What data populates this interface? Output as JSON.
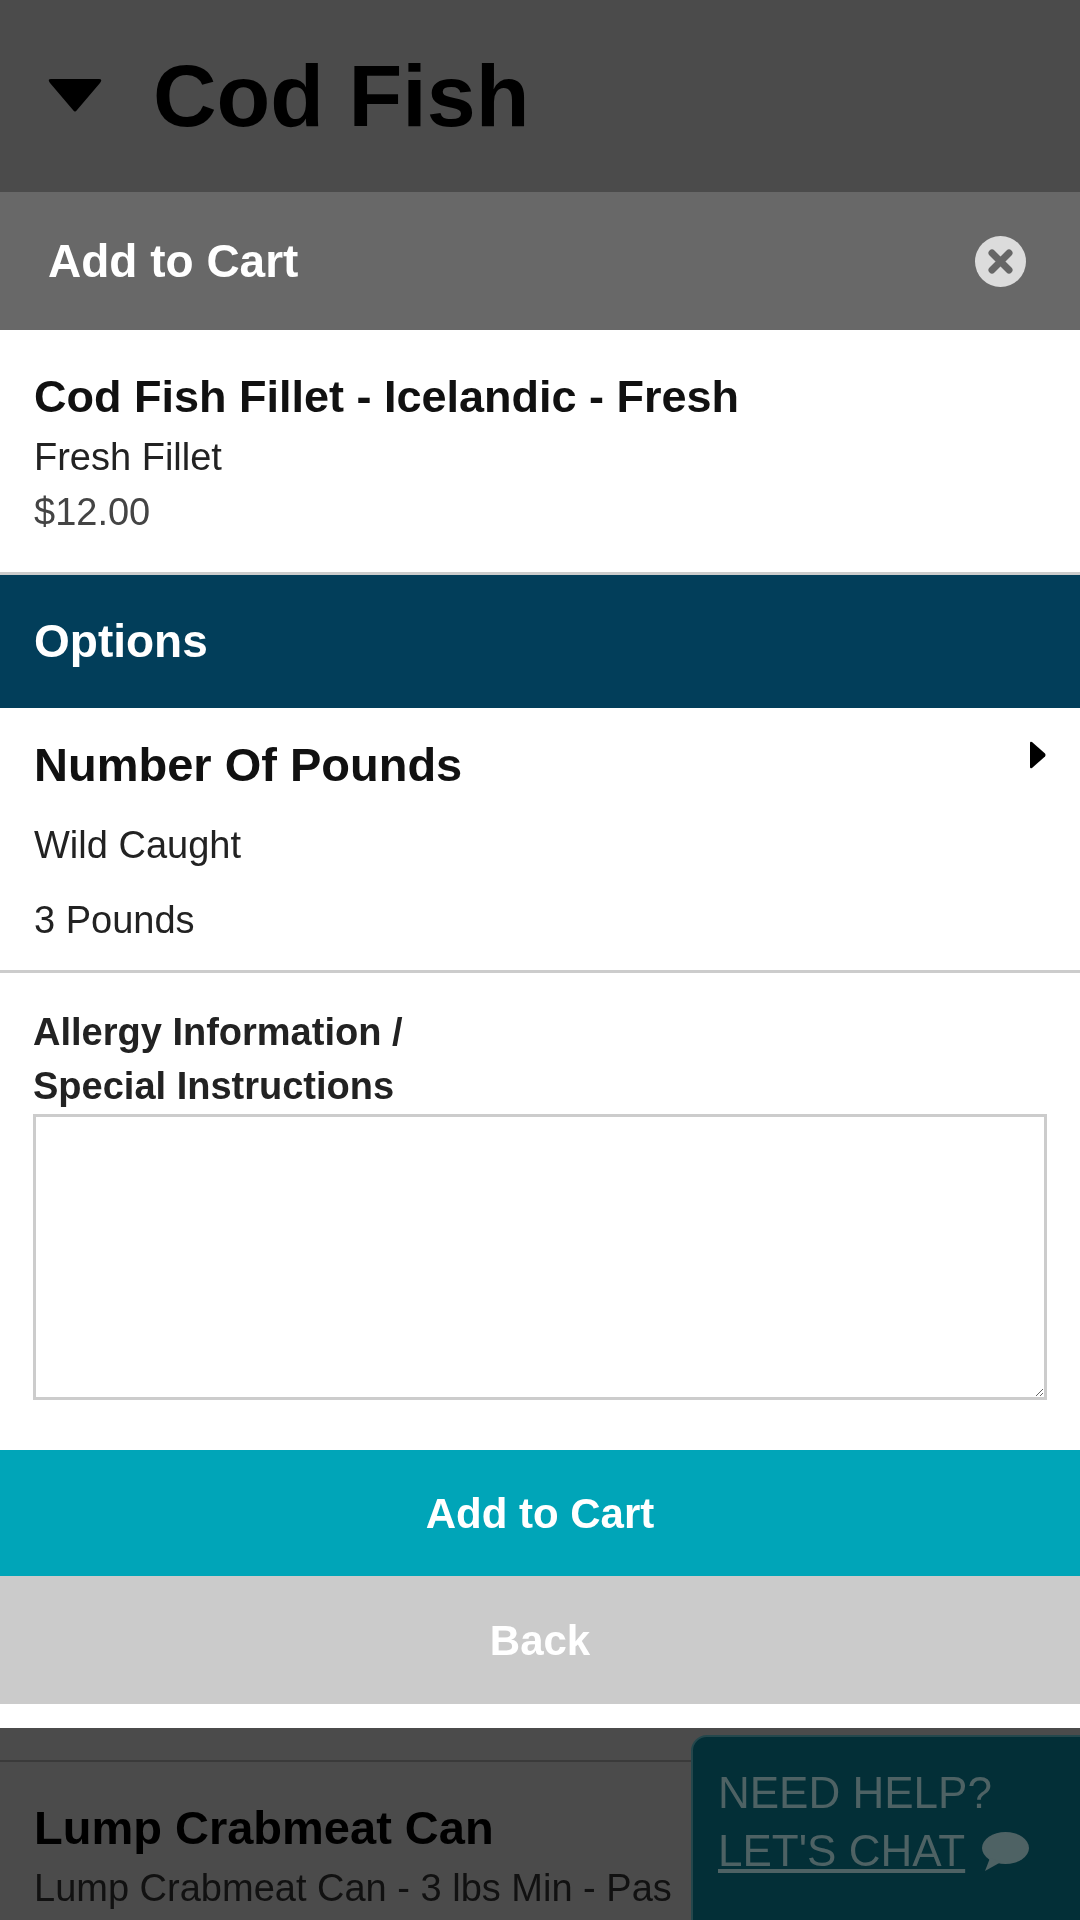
{
  "page_header": {
    "title": "Cod Fish",
    "expanded": true
  },
  "dialog": {
    "title": "Add to Cart",
    "product": {
      "name": "Cod Fish Fillet - Icelandic - Fresh",
      "variant": "Fresh Fillet",
      "price": "$12.00"
    },
    "options_heading": "Options",
    "options": [
      {
        "title": "Number Of Pounds",
        "values": [
          "Wild Caught",
          "3 Pounds"
        ]
      }
    ],
    "notes": {
      "label": "Allergy Information / Special Instructions"
    },
    "buttons": [
      {
        "label": "Add to Cart",
        "kind": "primary"
      },
      {
        "label": "Back",
        "kind": "secondary"
      }
    ]
  },
  "product_list": [
    {
      "name": "Lump Crabmeat Can",
      "description": "Lump Crabmeat Can - 3 lbs Min - Pas"
    }
  ],
  "chat": {
    "prompt": "NEED HELP?",
    "link": "LET'S CHAT"
  }
}
